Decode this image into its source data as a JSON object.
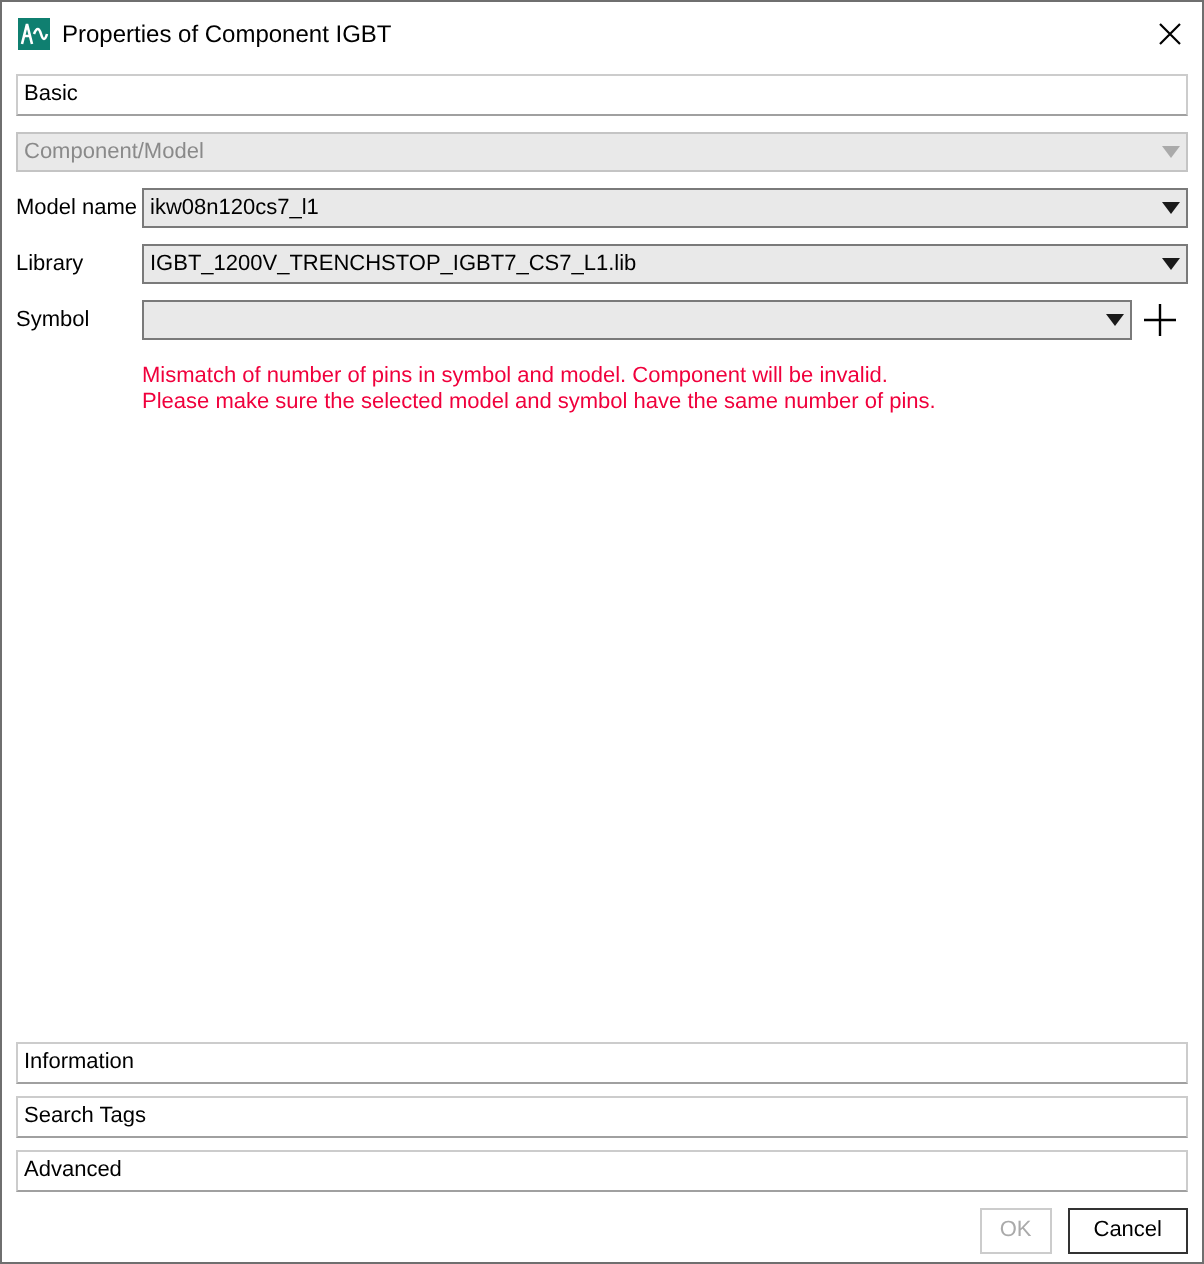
{
  "window": {
    "title": "Properties of Component IGBT"
  },
  "basic_section": {
    "title": "Basic"
  },
  "component_model": {
    "value": "Component/Model",
    "disabled": true
  },
  "fields": [
    {
      "label": "Model name",
      "value": "ikw08n120cs7_l1",
      "add_button": false
    },
    {
      "label": "Library",
      "value": "IGBT_1200V_TRENCHSTOP_IGBT7_CS7_L1.lib",
      "add_button": false
    },
    {
      "label": "Symbol",
      "add_button": true
    }
  ],
  "error_lines": [
    "Mismatch of number of pins in symbol and model. Component will be invalid.",
    "Please make sure the selected model and symbol have the same number of pins."
  ],
  "collapsed_sections": [
    {
      "title": "Information"
    },
    {
      "title": "Search Tags"
    },
    {
      "title": "Advanced"
    }
  ],
  "buttons": [
    {
      "label": "OK",
      "disabled": true
    },
    {
      "label": "Cancel",
      "disabled": false
    }
  ]
}
